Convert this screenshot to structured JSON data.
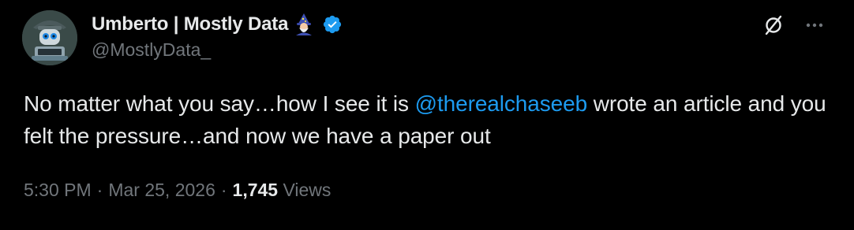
{
  "author": {
    "display_name": "Umberto | Mostly Data",
    "handle": "@MostlyData_",
    "verified": true,
    "name_emoji": "mage-emoji",
    "avatar": "robot-avatar"
  },
  "actions": {
    "grok_icon": "grok-icon",
    "more_icon": "more-options-icon"
  },
  "tweet": {
    "text_before": "No matter what you say…how I see it is ",
    "mention": "@therealchaseeb",
    "text_after": " wrote an article and you felt the pressure…and now we have a paper out"
  },
  "meta": {
    "time": "5:30 PM",
    "separator": "·",
    "date": "Mar 25, 2026",
    "views_count": "1,745",
    "views_label": "Views"
  },
  "colors": {
    "background": "#000000",
    "text": "#e7e9ea",
    "secondary": "#71767b",
    "accent": "#1d9bf0"
  }
}
